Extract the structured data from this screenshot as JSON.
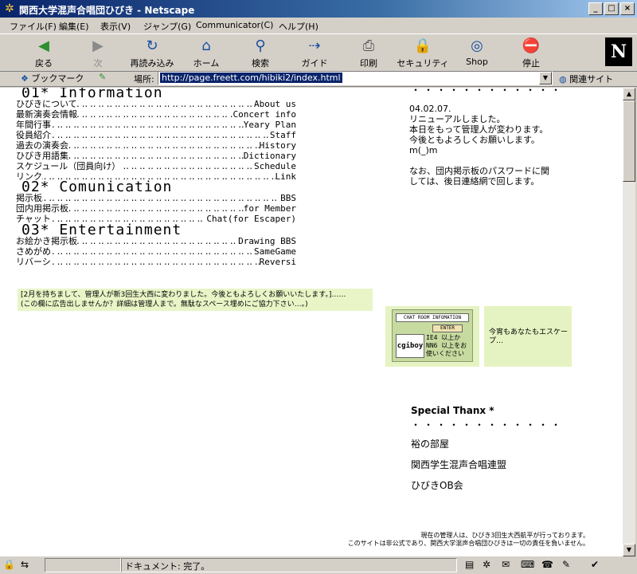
{
  "window": {
    "title": "関西大学混声合唱団ひびき - Netscape",
    "buttons": [
      "_",
      "□",
      "×"
    ]
  },
  "menu": [
    "ファイル(F)",
    "編集(E)",
    "表示(V)",
    "ジャンプ(G)",
    "Communicator(C)",
    "ヘルプ(H)"
  ],
  "toolbar": [
    {
      "label": "戻る",
      "icon": "back-arrow-icon",
      "glyph": "◀"
    },
    {
      "label": "次",
      "icon": "forward-arrow-icon",
      "glyph": "▶"
    },
    {
      "label": "再読み込み",
      "icon": "reload-icon",
      "glyph": "↻"
    },
    {
      "label": "ホーム",
      "icon": "home-icon",
      "glyph": "⌂"
    },
    {
      "label": "検索",
      "icon": "search-icon",
      "glyph": "⚲"
    },
    {
      "label": "ガイド",
      "icon": "guide-icon",
      "glyph": "⇢"
    },
    {
      "label": "印刷",
      "icon": "print-icon",
      "glyph": "⎙"
    },
    {
      "label": "セキュリティ",
      "icon": "lock-icon",
      "glyph": "🔒"
    },
    {
      "label": "Shop",
      "icon": "shop-icon",
      "glyph": "◎"
    },
    {
      "label": "停止",
      "icon": "stop-icon",
      "glyph": "⛔"
    }
  ],
  "logo": "N",
  "location": {
    "bookmark_label": "ブックマーク",
    "location_label": "場所:",
    "url": "http://page.freett.com/hibiki2/index.html",
    "related_label": "関連サイト"
  },
  "sections": [
    {
      "title": "01* Information",
      "items": [
        {
          "left": "ひびきについて",
          "right": "About us"
        },
        {
          "left": "最新演奏会情報",
          "right": "Concert info"
        },
        {
          "left": "年間行事",
          "right": "Yeary Plan"
        },
        {
          "left": "役員紹介",
          "right": "Staff"
        },
        {
          "left": "過去の演奏会",
          "right": "History"
        },
        {
          "left": "ひびき用語集",
          "right": "Dictionary"
        },
        {
          "left": "スケジュール（団員向け）",
          "right": "Schedule"
        },
        {
          "left": "リンク",
          "right": "Link"
        }
      ]
    },
    {
      "title": "02* Comunication",
      "items": [
        {
          "left": "掲示板",
          "right": "BBS"
        },
        {
          "left": "団内用掲示板",
          "right": "for Member"
        },
        {
          "left": "チャット",
          "right": "Chat(for Escaper)"
        }
      ]
    },
    {
      "title": "03* Entertainment",
      "items": [
        {
          "left": "お絵かき掲示板",
          "right": "Drawing BBS"
        },
        {
          "left": "さめがめ",
          "right": "SameGame"
        },
        {
          "left": "リバーシ",
          "right": "Reversi"
        }
      ]
    }
  ],
  "news": {
    "date": "04.02.07.",
    "line1": "リニューアルしました。",
    "line2": "本日をもって管理人が変わります。今後ともよろしくお願いします。m(_)m",
    "line3": "なお、団内掲示板のパスワードに関しては、後日連絡網で回します。"
  },
  "ad": {
    "line1": "[2月を持ちまして、管理人が新3回生大西に変わりました。今後ともよろしくお願いいたします。]……",
    "line2": "(この欄に広告出しませんか？詳細は管理人まで。無駄なスペース埋めにご協力下さい…。)"
  },
  "chat_banner": {
    "title": "CHAT ROOM INFOMATION",
    "enter": "ENTER",
    "logo": "cgiboy",
    "note": "IE4 以上か NN6 以上をお使いください"
  },
  "escape_text": "今宵もあなたもエスケープ…",
  "thanx": {
    "title": "Special Thanx *",
    "links": [
      "裕の部屋",
      "関西学生混声合唱連盟",
      "ひびきOB会"
    ]
  },
  "footer": {
    "line1": "現在の管理人は、ひびき3回生大西航平が行っております。",
    "line2": "このサイトは非公式であり、関西大学混声合唱団ひびきは一切の責任を負いません。"
  },
  "status": {
    "text": "ドキュメント: 完了。"
  }
}
